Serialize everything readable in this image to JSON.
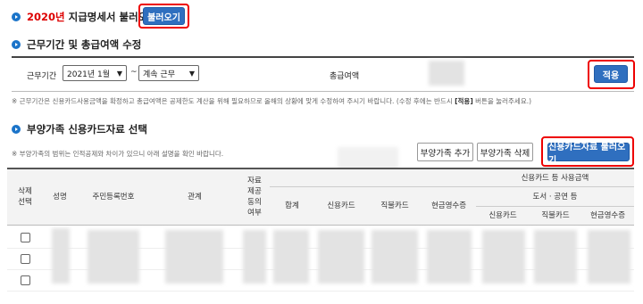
{
  "section1": {
    "year": "2020년",
    "title": "지급명세서 불러오기",
    "load_button": "불러오기"
  },
  "section2": {
    "title": "근무기간 및 총급여액 수정",
    "period_label": "근무기간",
    "start_value": "2021년 1월",
    "end_value": "계속 근무",
    "total_label": "총급여액",
    "apply_button": "적용",
    "note_prefix": "※ 근무기간은 신용카드사용금액을 확정하고 총급여액은 공제한도 계산을 위해 필요하므로 올해의 상황에 맞게 수정하여 주시기 바랍니다. (수정 후에는 반드시 ",
    "note_bold": "[적용]",
    "note_suffix": " 버튼을 눌러주세요.)"
  },
  "section3": {
    "title": "부양가족 신용카드자료 선택",
    "note": "※ 부양가족의 범위는 인적공제와 차이가 있으니 아래 설명을 확인 바랍니다.",
    "add_button": "부양가족 추가",
    "delete_button": "부양가족 삭제",
    "card_load_button": "신용카드자료 불러오기"
  },
  "table": {
    "col_delete": "삭제\n선택",
    "col_name": "성명",
    "col_rrn": "주민등록번호",
    "col_relation": "관계",
    "col_provided": "자료\n제공\n동의\n여부",
    "group_card": "신용카드 등 사용금액",
    "col_total": "합계",
    "col_credit": "신용카드",
    "col_debit": "직불카드",
    "col_cash": "현금영수증",
    "group_culture": "도서 · 공연 등",
    "sub_credit": "신용카드",
    "sub_debit": "직불카드",
    "sub_cash": "현금영수증"
  },
  "colors": {
    "accent": "#2f6fbf",
    "highlight": "#e00000",
    "title_red": "#d00000"
  }
}
